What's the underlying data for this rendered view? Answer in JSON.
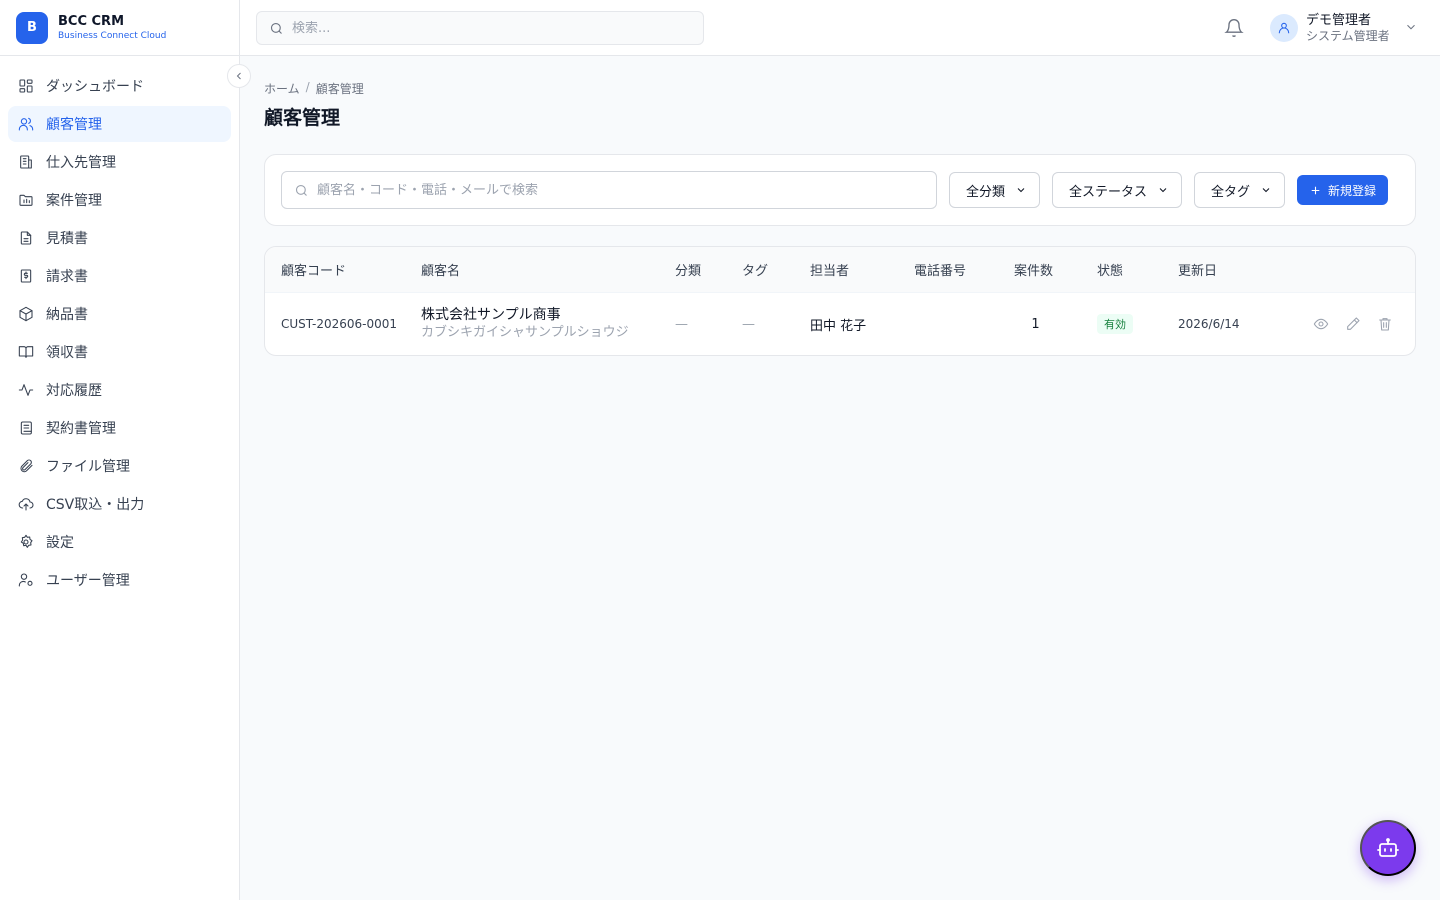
{
  "brand": {
    "logo_letter": "B",
    "name": "BCC CRM",
    "subtitle": "Business Connect Cloud"
  },
  "sidebar": {
    "items": [
      {
        "label": "ダッシュボード",
        "icon": "dashboard-icon"
      },
      {
        "label": "顧客管理",
        "icon": "users-icon",
        "active": true
      },
      {
        "label": "仕入先管理",
        "icon": "building-icon"
      },
      {
        "label": "案件管理",
        "icon": "folder-icon"
      },
      {
        "label": "見積書",
        "icon": "document-icon"
      },
      {
        "label": "請求書",
        "icon": "invoice-icon"
      },
      {
        "label": "納品書",
        "icon": "package-icon"
      },
      {
        "label": "領収書",
        "icon": "book-icon"
      },
      {
        "label": "対応履歴",
        "icon": "activity-icon"
      },
      {
        "label": "契約書管理",
        "icon": "scroll-icon"
      },
      {
        "label": "ファイル管理",
        "icon": "paperclip-icon"
      },
      {
        "label": "CSV取込・出力",
        "icon": "cloud-upload-icon"
      },
      {
        "label": "設定",
        "icon": "gear-icon"
      },
      {
        "label": "ユーザー管理",
        "icon": "user-cog-icon"
      }
    ]
  },
  "header": {
    "search_placeholder": "検索...",
    "user_name": "デモ管理者",
    "user_role": "システム管理者"
  },
  "main": {
    "breadcrumb": {
      "home": "ホーム",
      "separator": "/",
      "current": "顧客管理"
    },
    "title": "顧客管理",
    "filters": {
      "search_placeholder": "顧客名・コード・電話・メールで検索",
      "category": "全分類",
      "status": "全ステータス",
      "tag": "全タグ",
      "new_label": "新規登録"
    },
    "table": {
      "headers": [
        "顧客コード",
        "顧客名",
        "分類",
        "タグ",
        "担当者",
        "電話番号",
        "案件数",
        "状態",
        "更新日"
      ],
      "rows": [
        {
          "code": "CUST-202606-0001",
          "name": "株式会社サンプル商事",
          "kana": "カブシキガイシャサンプルショウジ",
          "category": "—",
          "tag": "—",
          "owner": "田中 花子",
          "phone": "",
          "deals": "1",
          "status": "有効",
          "updated": "2026/6/14"
        }
      ]
    }
  },
  "colors": {
    "accent": "#2563eb",
    "active_bg": "#eff6ff",
    "status_green": "#15803d",
    "bot": "#7c3aed"
  }
}
